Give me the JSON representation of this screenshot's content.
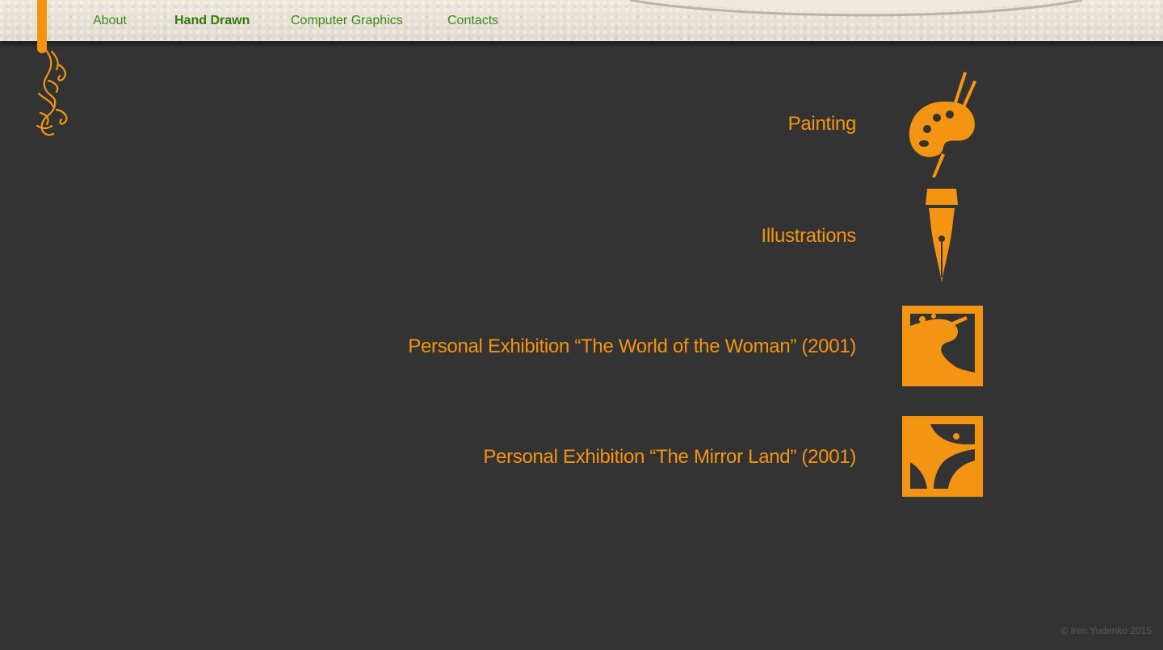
{
  "nav": {
    "items": [
      {
        "label": "About",
        "active": false
      },
      {
        "label": "Hand Drawn",
        "active": true
      },
      {
        "label": "Computer Graphics",
        "active": false
      },
      {
        "label": "Contacts",
        "active": false
      }
    ]
  },
  "logo": {
    "text": "Iren Yudenko"
  },
  "categories": [
    {
      "label": "Painting",
      "icon": "palette-icon"
    },
    {
      "label": "Illustrations",
      "icon": "fountain-pen-icon"
    },
    {
      "label": "Personal Exhibition “The World of the Woman” (2001)",
      "icon": "tree-frame-icon"
    },
    {
      "label": "Personal Exhibition “The Mirror Land” (2001)",
      "icon": "mirror-land-frame-icon"
    }
  ],
  "footer": {
    "copyright": "© Iren Yudenko 2015"
  },
  "colors": {
    "accent": "#f39512",
    "nav_text": "#3b8a12",
    "background": "#333333",
    "topbar": "#e7e0d6"
  }
}
